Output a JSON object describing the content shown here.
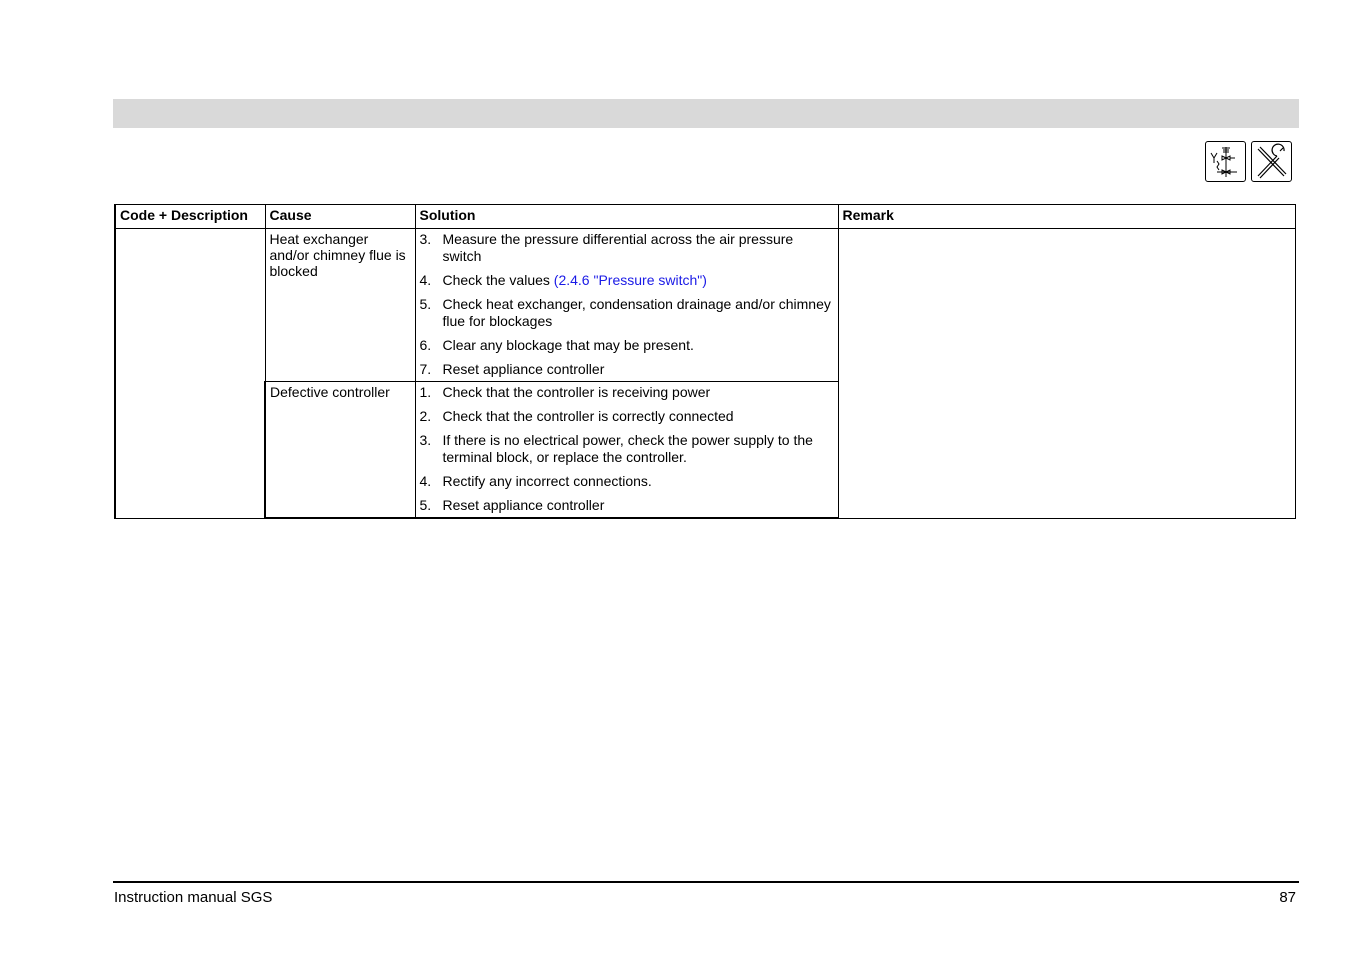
{
  "icons": {
    "first": "hydraulic-diagram-icon",
    "second": "tools-icon"
  },
  "table": {
    "headers": {
      "code": "Code + Description",
      "cause": "Cause",
      "solution": "Solution",
      "remark": "Remark"
    },
    "rows": [
      {
        "code": "",
        "cause": "Heat exchanger and/or chimney flue is blocked",
        "steps": [
          {
            "num": "3.",
            "text": "Measure the pressure differential across the air pressure switch"
          },
          {
            "num": "4.",
            "text": "Check the values ",
            "link": "(2.4.6 \"Pressure switch\")"
          },
          {
            "num": "5.",
            "text": "Check heat exchanger, condensation drainage and/or chimney flue for blockages"
          },
          {
            "num": "6.",
            "text": "Clear any blockage that may be present."
          },
          {
            "num": "7.",
            "text": "Reset appliance controller"
          }
        ],
        "remark": ""
      },
      {
        "cause": "Defective controller",
        "steps": [
          {
            "num": "1.",
            "text": "Check that the controller is receiving power"
          },
          {
            "num": "2.",
            "text": "Check that the controller is correctly connected"
          },
          {
            "num": "3.",
            "text": "If there is no electrical power, check the power supply to the terminal block, or replace the controller."
          },
          {
            "num": "4.",
            "text": "Rectify any incorrect connections."
          },
          {
            "num": "5.",
            "text": "Reset appliance controller"
          }
        ]
      }
    ]
  },
  "footer": {
    "title": "Instruction manual SGS",
    "page": "87"
  }
}
